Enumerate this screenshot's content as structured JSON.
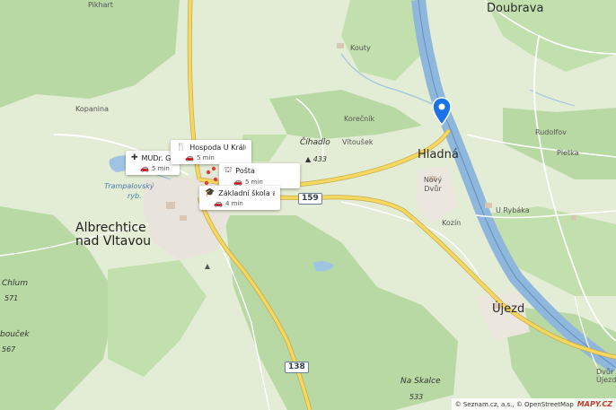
{
  "map": {
    "places": {
      "doubrava": "Doubrava",
      "pikhart": "Pikhart",
      "kouty": "Kouty",
      "kopanina": "Kopanina",
      "korecnik": "Korečník",
      "vitousek": "Vítoušek",
      "hladna": "Hladná",
      "novy_dvur": "Nový Dvůr",
      "kozin": "Kozín",
      "u_rybaka": "U Rybáka",
      "rudolfov": "Rudolfov",
      "pletka": "Pletka",
      "albrechtice_1": "Albrechtice",
      "albrechtice_2": "nad Vltavou",
      "ujezd": "Újezd",
      "dvur_1": "Dvůr",
      "dvur_2": "Újezd"
    },
    "peaks": {
      "cihadlo": {
        "name": "Číhadlo",
        "elev": "433"
      },
      "chlum": {
        "name": "Chlum",
        "elev": "571"
      },
      "bouckoy": {
        "name": "bouček",
        "elev": "567"
      },
      "na_skalce": {
        "name": "Na Skalce",
        "elev": "533"
      }
    },
    "water": {
      "trampalovsky_1": "Trampalovský",
      "trampalovsky_2": "ryb."
    },
    "roads": {
      "r159": "159",
      "r138": "138"
    }
  },
  "pois": [
    {
      "name": "MUDr. Glü",
      "time": "5 min",
      "icon": "medical-icon"
    },
    {
      "name": "Hospoda U Králů",
      "time": "5 min",
      "icon": "restaurant-icon"
    },
    {
      "name": "Pošta",
      "time": "5 min",
      "icon": "post-office-icon"
    },
    {
      "name": "Základní škola a ...",
      "time": "4 min",
      "icon": "school-icon"
    }
  ],
  "marker": {
    "icon": "location-pin-icon",
    "color": "#1a73e8"
  },
  "attribution": {
    "text": "© Seznam.cz, a.s., © OpenStreetMap",
    "logo": "MAPY.CZ"
  }
}
